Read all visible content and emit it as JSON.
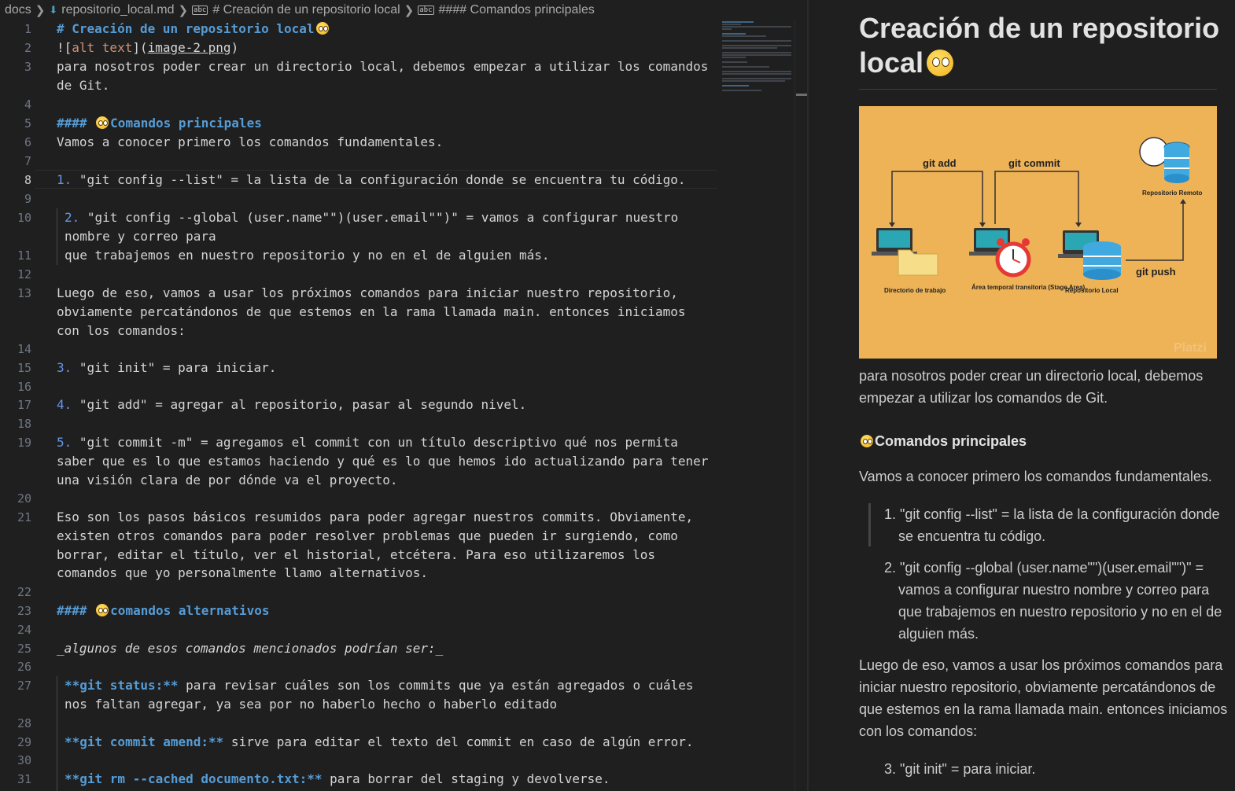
{
  "breadcrumb": {
    "items": [
      "docs",
      "repositorio_local.md",
      "# Creación de un repositorio local",
      "#### Comandos principales"
    ]
  },
  "editor": {
    "lines": {
      "l1": {
        "num": "1",
        "heading": "# Creación de un repositorio local"
      },
      "l2": {
        "num": "2",
        "bang": "![",
        "alt": "alt text",
        "mid": "](",
        "link": "image-2.png",
        "end": ")"
      },
      "l3": {
        "num": "3",
        "text": "para nosotros poder crear un directorio local, debemos empezar a utilizar los comandos de Git."
      },
      "l4": {
        "num": "4"
      },
      "l5": {
        "num": "5",
        "hashes": "####",
        "text": "Comandos principales"
      },
      "l6": {
        "num": "6",
        "text": "Vamos a conocer primero los comandos fundamentales."
      },
      "l7": {
        "num": "7"
      },
      "l8": {
        "num": "8",
        "marker": "1.",
        "text": " \"git config --list\" = la lista de la configuración donde se encuentra tu código."
      },
      "l9": {
        "num": "9"
      },
      "l10": {
        "num": "10",
        "marker": "2.",
        "text": " \"git config --global (user.name\"\")(user.email\"\")\" = vamos a configurar nuestro nombre y correo para"
      },
      "l11": {
        "num": "11",
        "text": "que trabajemos en nuestro repositorio y no en el de alguien más."
      },
      "l12": {
        "num": "12"
      },
      "l13": {
        "num": "13",
        "text": "Luego de eso, vamos a usar los próximos comandos para iniciar nuestro repositorio, obviamente percatándonos de que estemos en la rama llamada main. entonces iniciamos con los comandos:"
      },
      "l14": {
        "num": "14"
      },
      "l15": {
        "num": "15",
        "marker": "3.",
        "text": " \"git init\" = para iniciar."
      },
      "l16": {
        "num": "16"
      },
      "l17": {
        "num": "17",
        "marker": "4.",
        "text": " \"git add\" = agregar al repositorio, pasar al segundo nivel."
      },
      "l18": {
        "num": "18"
      },
      "l19": {
        "num": "19",
        "marker": "5.",
        "text": " \"git commit -m\" = agregamos el commit con un título descriptivo qué nos permita saber que es lo que estamos haciendo y qué es lo que hemos ido actualizando para tener una visión clara de por dónde va el proyecto."
      },
      "l20": {
        "num": "20"
      },
      "l21": {
        "num": "21",
        "text": "Eso son los pasos básicos resumidos para poder agregar nuestros commits. Obviamente, existen otros comandos para poder resolver problemas que pueden ir surgiendo, como borrar, editar el título, ver el historial, etcétera. Para eso utilizaremos los comandos que yo personalmente llamo alternativos."
      },
      "l22": {
        "num": "22"
      },
      "l23": {
        "num": "23",
        "hashes": "####",
        "text": "comandos alternativos"
      },
      "l24": {
        "num": "24"
      },
      "l25": {
        "num": "25",
        "text": "_algunos de esos comandos mencionados podrían ser:_"
      },
      "l26": {
        "num": "26"
      },
      "l27": {
        "num": "27",
        "bold": "**git status:**",
        "text": " para revisar cuáles son los commits que ya están agregados o cuáles nos faltan agregar, ya sea por no haberlo hecho o haberlo editado"
      },
      "l28": {
        "num": "28"
      },
      "l29": {
        "num": "29",
        "bold": "**git commit amend:**",
        "text": " sirve para editar el texto del commit en caso de algún error."
      },
      "l30": {
        "num": "30"
      },
      "l31": {
        "num": "31",
        "bold": "**git rm --cached documento.txt:**",
        "text": " para borrar del staging y devolverse."
      }
    }
  },
  "preview": {
    "title": "Creación de un repositorio local",
    "image": {
      "labels": {
        "git_add": "git add",
        "git_commit": "git commit",
        "git_push": "git push",
        "remote": "Repositorio Remoto",
        "workdir": "Directorio de trabajo",
        "staging": "Área temporal transitoria (Stage Area)",
        "local": "Repositorio Local",
        "watermark": "Platzi"
      }
    },
    "p1": "para nosotros poder crear un directorio local, debemos empezar a utilizar los comandos de Git.",
    "h4": "Comandos principales",
    "p2": "Vamos a conocer primero los comandos fundamentales.",
    "li1": "1. \"git config --list\" = la lista de la configuración donde se encuentra tu código.",
    "li2": "2. \"git config --global (user.name\"\")(user.email\"\")\" = vamos a configurar nuestro nombre y correo para que trabajemos en nuestro repositorio y no en el de alguien más.",
    "p3": "Luego de eso, vamos a usar los próximos comandos para iniciar nuestro repositorio, obviamente percatándonos de que estemos en la rama llamada main. entonces iniciamos con los comandos:",
    "li3": "3. \"git init\" = para iniciar."
  },
  "colors": {
    "heading": "#569cd6",
    "list_number": "#6796e6",
    "link_alt": "#ce9178",
    "image_background": "#eeb357"
  }
}
